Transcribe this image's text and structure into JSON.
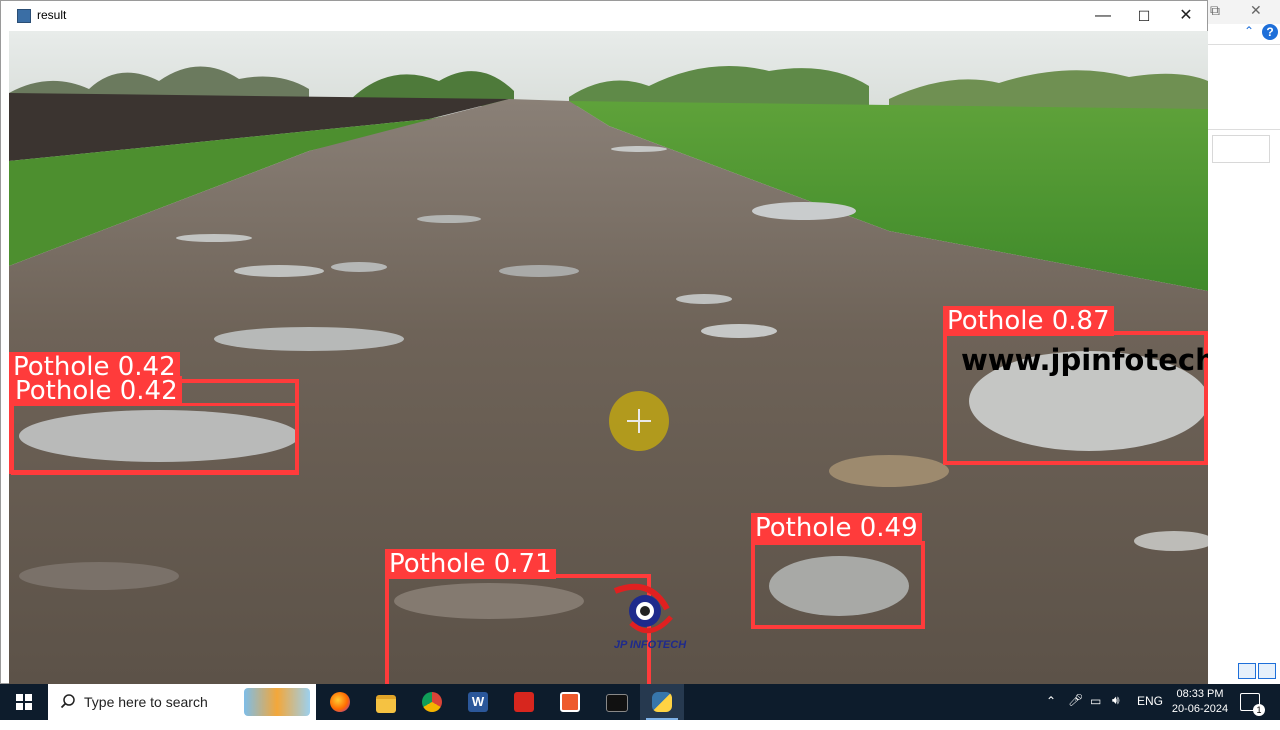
{
  "window": {
    "title": "result",
    "controls": {
      "minimize": "—",
      "maximize": "☐",
      "close": "✕"
    }
  },
  "detections": [
    {
      "label": "Pothole 0.42",
      "confidence": 0.42
    },
    {
      "label": "Pothole 0.42",
      "confidence": 0.42
    },
    {
      "label": "Pothole 0.87",
      "confidence": 0.87
    },
    {
      "label": "Pothole 0.49",
      "confidence": 0.49
    },
    {
      "label": "Pothole 0.71",
      "confidence": 0.71
    }
  ],
  "overlay": {
    "watermark": "www.jpinfotech.org",
    "logo_text": "JP INFOTECH"
  },
  "background_app": {
    "help": "?",
    "chevron": "⌃"
  },
  "taskbar": {
    "search_placeholder": "Type here to search",
    "apps": [
      "cortana-ai",
      "firefox",
      "file-explorer",
      "chrome",
      "word",
      "acrobat",
      "app-c",
      "terminal",
      "python"
    ],
    "tray": {
      "language": "ENG",
      "time": "08:33 PM",
      "date": "20-06-2024",
      "notification_count": "1"
    }
  },
  "colors": {
    "detection": "#ff3b3b",
    "taskbar": "#0d1c2c",
    "accent": "#1e6fd9"
  }
}
